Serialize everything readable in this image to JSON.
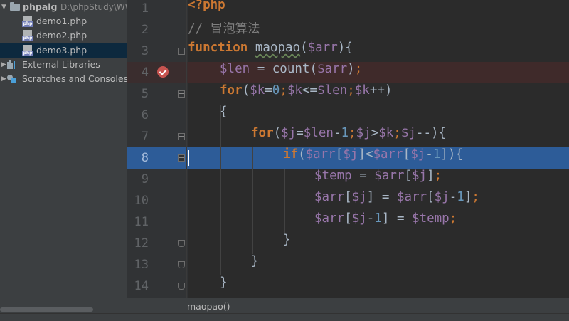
{
  "project": {
    "root": {
      "name": "phpalg",
      "path": "D:\\phpStudy\\WW"
    },
    "files": [
      {
        "name": "demo1.php",
        "selected": false
      },
      {
        "name": "demo2.php",
        "selected": false
      },
      {
        "name": "demo3.php",
        "selected": true
      }
    ],
    "external_libraries": "External Libraries",
    "scratches": "Scratches and Consoles"
  },
  "editor": {
    "line_numbers": [
      "1",
      "2",
      "3",
      "4",
      "5",
      "6",
      "7",
      "8",
      "9",
      "10",
      "11",
      "12",
      "13",
      "14"
    ],
    "breakpoint_line": 4,
    "execution_line": 8,
    "code": {
      "l1_tag": "<?php",
      "l2_comment": "// 冒泡算法",
      "l3_function": "function",
      "l3_name": "maopao",
      "l3_open": "(",
      "l3_param": "$arr",
      "l3_close": "){",
      "l4_var": "$len",
      "l4_eq": " = ",
      "l4_fn": "count",
      "l4_open": "(",
      "l4_arg": "$arr",
      "l4_close": ")",
      "l4_semi": ";",
      "l5_for": "for",
      "l5_p1": "(",
      "l5_k1": "$k",
      "l5_eq": "=",
      "l5_zero": "0",
      "l5_s1": ";",
      "l5_k2": "$k",
      "l5_le": "<=",
      "l5_len": "$len",
      "l5_s2": ";",
      "l5_k3": "$k",
      "l5_inc": "++)",
      "l6": "{",
      "l7_for": "for",
      "l7_p1": "(",
      "l7_j1": "$j",
      "l7_eq": "=",
      "l7_len": "$len",
      "l7_minus": "-",
      "l7_one": "1",
      "l7_s1": ";",
      "l7_j2": "$j",
      "l7_gt": ">",
      "l7_k": "$k",
      "l7_s2": ";",
      "l7_j3": "$j",
      "l7_dec": "--){",
      "l8_if": "if",
      "l8_p1": "(",
      "l8_arr1": "$arr",
      "l8_b1": "[",
      "l8_j1": "$j",
      "l8_b2": "]<",
      "l8_arr2": "$arr",
      "l8_b3": "[",
      "l8_j2": "$j",
      "l8_m": "-",
      "l8_one": "1",
      "l8_b4": "]){",
      "l9_temp": "$temp",
      "l9_eq": " = ",
      "l9_arr": "$arr",
      "l9_b1": "[",
      "l9_j": "$j",
      "l9_b2": "]",
      "l9_semi": ";",
      "l10_arr1": "$arr",
      "l10_b1": "[",
      "l10_j1": "$j",
      "l10_b2": "] = ",
      "l10_arr2": "$arr",
      "l10_b3": "[",
      "l10_j2": "$j",
      "l10_m": "-",
      "l10_one": "1",
      "l10_b4": "]",
      "l10_semi": ";",
      "l11_arr": "$arr",
      "l11_b1": "[",
      "l11_j": "$j",
      "l11_m": "-",
      "l11_one": "1",
      "l11_b2": "] = ",
      "l11_temp": "$temp",
      "l11_semi": ";",
      "l12": "}",
      "l13": "}",
      "l14": "}"
    }
  },
  "breadcrumb": "maopao()",
  "colors": {
    "keyword": "#cc7832",
    "variable": "#9876aa",
    "number": "#6897bb",
    "comment": "#808080",
    "execution_highlight": "#2d5c98",
    "breakpoint": "#c75450"
  }
}
